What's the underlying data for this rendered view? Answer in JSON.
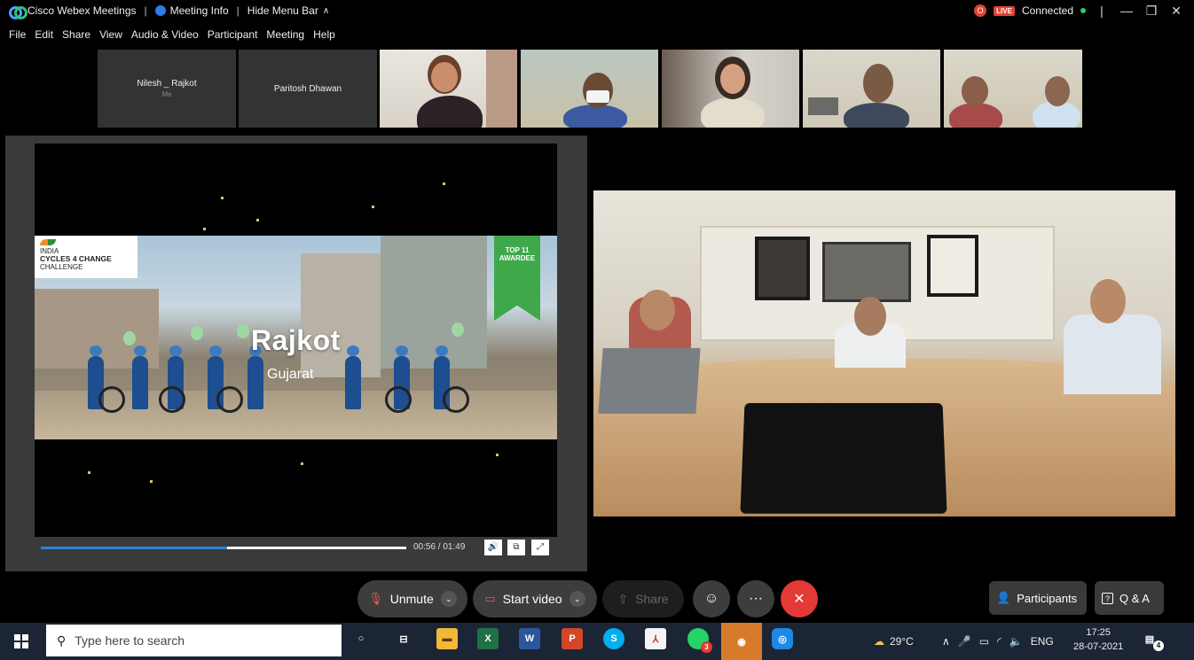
{
  "titlebar": {
    "app_name": "Cisco Webex Meetings",
    "meeting_info": "Meeting Info",
    "hide_menu": "Hide Menu Bar",
    "rec_icon_text": "O",
    "live_badge": "LIVE",
    "status": "Connected",
    "window_controls": [
      "—",
      "❐",
      "✕"
    ]
  },
  "menu": [
    "File",
    "Edit",
    "Share",
    "View",
    "Audio & Video",
    "Participant",
    "Meeting",
    "Help"
  ],
  "participants": [
    {
      "name": "Nilesh _ Rajkot",
      "sub": "Me"
    },
    {
      "name": "Paritosh Dhawan",
      "sub": ""
    }
  ],
  "shared_video": {
    "logo_line1": "INDIA",
    "logo_line2": "CYCLES 4 CHANGE",
    "logo_line3": "CHALLENGE",
    "award_line1": "TOP 11",
    "award_line2": "AWARDEE",
    "city": "Rajkot",
    "state": "Gujarat",
    "time": "00:56 / 01:49",
    "progress": 0.51
  },
  "controls": {
    "unmute": "Unmute",
    "start_video": "Start video",
    "share": "Share",
    "more": "···",
    "end": "✕",
    "participants": "Participants",
    "qa": "Q & A"
  },
  "taskbar": {
    "search_placeholder": "Type here to search",
    "weather": "29°C",
    "lang": "ENG",
    "time": "17:25",
    "date": "28-07-2021",
    "notif_count": "4",
    "whatsapp_badge": "3"
  },
  "colors": {
    "accent_blue": "#2f84d6",
    "end_red": "#e53935",
    "award_green": "#3fa84b"
  }
}
